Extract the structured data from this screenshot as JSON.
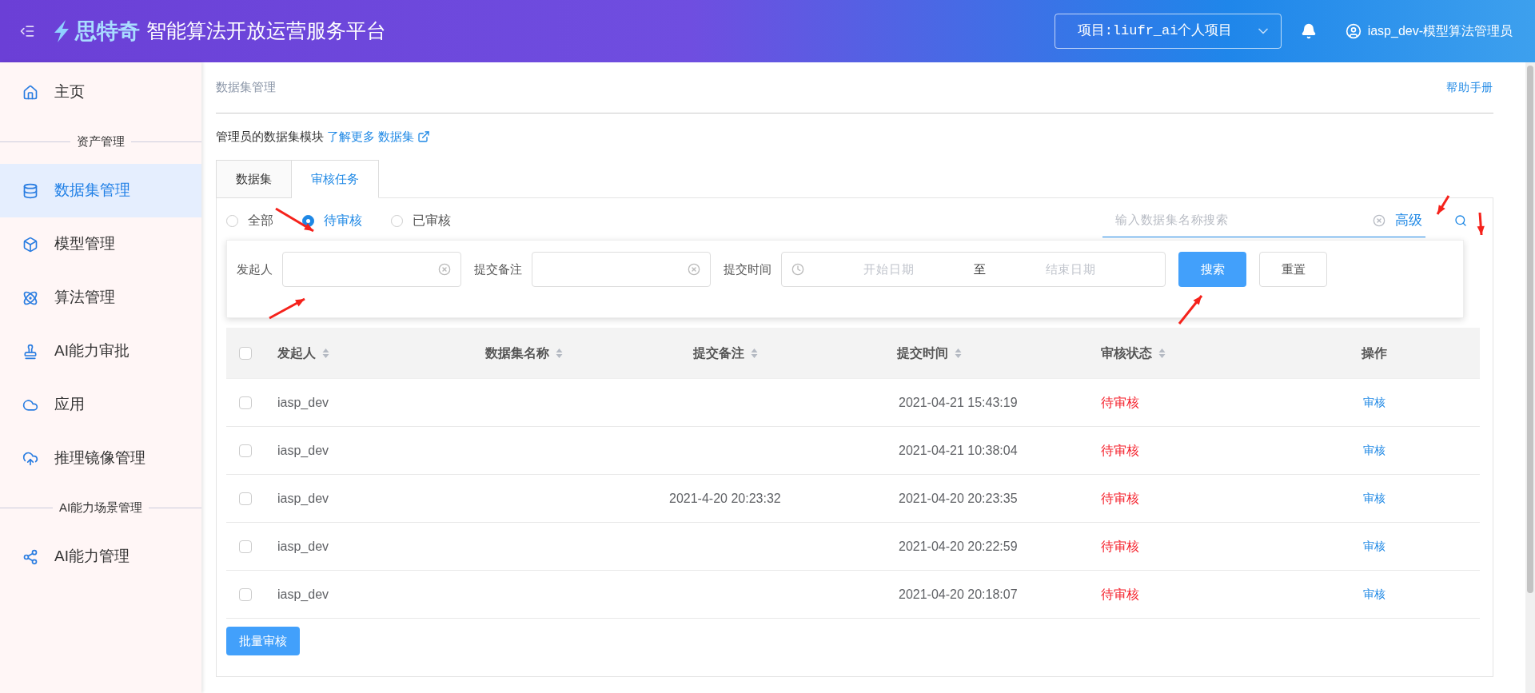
{
  "header": {
    "logo_text": "思特奇",
    "title": "智能算法开放运营服务平台",
    "project_select": "项目:liufr_ai个人项目",
    "user": "iasp_dev-模型算法管理员"
  },
  "sidebar": {
    "items": [
      {
        "kind": "item",
        "label": "主页",
        "selected": false
      },
      {
        "kind": "section",
        "label": "资产管理"
      },
      {
        "kind": "item",
        "label": "数据集管理",
        "selected": true
      },
      {
        "kind": "item",
        "label": "模型管理",
        "selected": false
      },
      {
        "kind": "item",
        "label": "算法管理",
        "selected": false
      },
      {
        "kind": "item",
        "label": "AI能力审批",
        "selected": false
      },
      {
        "kind": "item",
        "label": "应用",
        "selected": false
      },
      {
        "kind": "item",
        "label": "推理镜像管理",
        "selected": false
      },
      {
        "kind": "section",
        "label": "AI能力场景管理"
      },
      {
        "kind": "item",
        "label": "AI能力管理",
        "selected": false
      }
    ]
  },
  "breadcrumb": "数据集管理",
  "help_link": "帮助手册",
  "description": {
    "text": "管理员的数据集模块",
    "link": "了解更多 数据集"
  },
  "tabs": [
    {
      "label": "数据集",
      "selected": false
    },
    {
      "label": "审核任务",
      "selected": true
    }
  ],
  "status_filter": [
    {
      "label": "全部",
      "selected": false
    },
    {
      "label": "待审核",
      "selected": true
    },
    {
      "label": "已审核",
      "selected": false
    }
  ],
  "search": {
    "placeholder": "输入数据集名称搜索",
    "advanced": "高级"
  },
  "filters": {
    "initiator_label": "发起人",
    "remark_label": "提交备注",
    "time_label": "提交时间",
    "start_placeholder": "开始日期",
    "range_separator": "至",
    "end_placeholder": "结束日期",
    "search_button": "搜索",
    "reset_button": "重置"
  },
  "table": {
    "select_all_checked": false,
    "columns": [
      {
        "label": "发起人",
        "sortable": true
      },
      {
        "label": "数据集名称",
        "sortable": true
      },
      {
        "label": "提交备注",
        "sortable": true
      },
      {
        "label": "提交时间",
        "sortable": true
      },
      {
        "label": "审核状态",
        "sortable": true
      },
      {
        "label": "操作",
        "sortable": false
      }
    ],
    "rows": [
      {
        "checked": false,
        "initiator": "iasp_dev",
        "remark": "",
        "time": "2021-04-21 15:43:19",
        "status": "待审核",
        "action": "审核"
      },
      {
        "checked": false,
        "initiator": "iasp_dev",
        "remark": "",
        "time": "2021-04-21 10:38:04",
        "status": "待审核",
        "action": "审核"
      },
      {
        "checked": false,
        "initiator": "iasp_dev",
        "remark": "2021-4-20 20:23:32",
        "time": "2021-04-20 20:23:35",
        "status": "待审核",
        "action": "审核"
      },
      {
        "checked": false,
        "initiator": "iasp_dev",
        "remark": "",
        "time": "2021-04-20 20:22:59",
        "status": "待审核",
        "action": "审核"
      },
      {
        "checked": false,
        "initiator": "iasp_dev",
        "remark": "",
        "time": "2021-04-20 20:18:07",
        "status": "待审核",
        "action": "审核"
      }
    ]
  },
  "batch_button": "批量审核"
}
